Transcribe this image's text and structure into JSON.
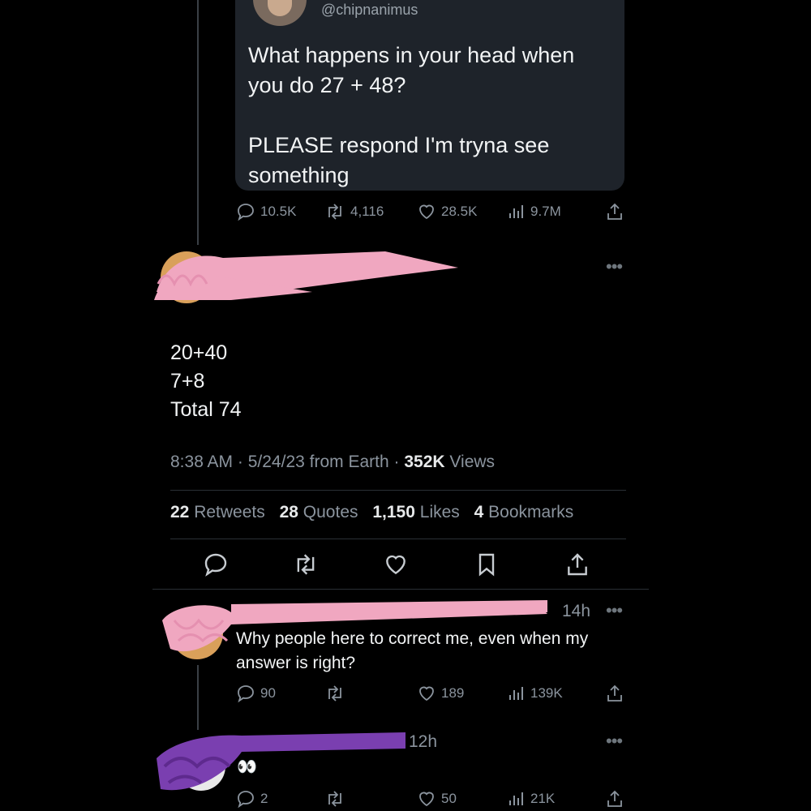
{
  "quoted_tweet": {
    "handle": "@chipnanimus",
    "text_line1": "What happens in your head when you do 27 + 48?",
    "text_line2": "PLEASE respond I'm tryna see something",
    "stats": {
      "replies": "10.5K",
      "retweets": "4,116",
      "likes": "28.5K",
      "views": "9.7M"
    }
  },
  "main_tweet": {
    "lines": [
      "20+40",
      "7+8",
      "Total 74"
    ],
    "time": "8:38 AM",
    "date": "5/24/23",
    "source": "from Earth",
    "views_count": "352K",
    "views_label": "Views",
    "retweets_count": "22",
    "retweets_label": "Retweets",
    "quotes_count": "28",
    "quotes_label": "Quotes",
    "likes_count": "1,150",
    "likes_label": "Likes",
    "bookmarks_count": "4",
    "bookmarks_label": "Bookmarks"
  },
  "reply1": {
    "time": "14h",
    "text": "Why people here to correct me, even when my answer is right?",
    "stats": {
      "replies": "90",
      "likes": "189",
      "views": "139K"
    }
  },
  "reply2": {
    "time": "12h",
    "text": "👀",
    "stats": {
      "replies": "2",
      "likes": "50",
      "views": "21K"
    }
  },
  "colors": {
    "background": "#000000",
    "card": "#1e232a",
    "pink_scribble": "#f0a7c0",
    "purple_scribble": "#7a3fb0"
  }
}
